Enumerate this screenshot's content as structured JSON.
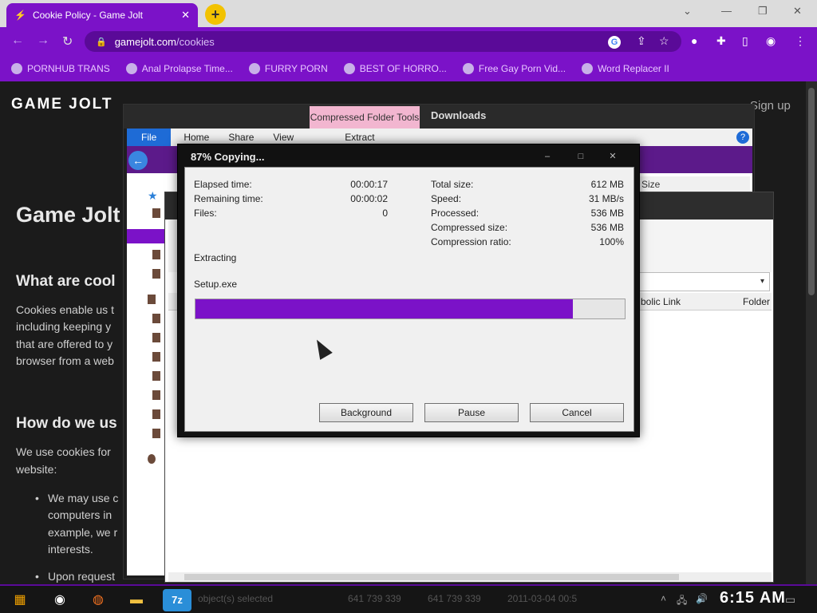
{
  "browser": {
    "tab_title": "Cookie Policy - Game Jolt",
    "tab_close": "✕",
    "new_tab": "+",
    "url_host": "gamejolt.com",
    "url_path": "/cookies",
    "min_glyph": "—",
    "restore_glyph": "❐",
    "close_glyph": "✕",
    "chevron_glyph": "⌄",
    "back_glyph": "←",
    "forward_glyph": "→",
    "reload_glyph": "↻",
    "lock_glyph": "🔒",
    "g_glyph": "G"
  },
  "bookmarks": [
    {
      "label": "PORNHUB TRANS"
    },
    {
      "label": "Anal Prolapse Time..."
    },
    {
      "label": "FURRY PORN"
    },
    {
      "label": "BEST OF HORRO..."
    },
    {
      "label": "Free Gay Porn Vid..."
    },
    {
      "label": "Word Replacer II"
    }
  ],
  "page": {
    "logo": "GAME JOLT",
    "signup": "Sign up",
    "title": "Game Jolt",
    "h_cookies": "What are cool",
    "p_cookies_1": "Cookies enable us t",
    "p_cookies_2": "including keeping y",
    "p_cookies_3": "that are offered to y",
    "p_cookies_4": "browser from a web",
    "h_how": "How do we us",
    "p_how_1": "We use cookies for",
    "p_how_2": "website:",
    "li_1a": "We may use c",
    "li_1b": "computers in",
    "li_1c": "example, we r",
    "li_1d": "interests.",
    "li_2a": "Upon request"
  },
  "explorer": {
    "tools_tab": "Compressed Folder Tools",
    "downloads": "Downloads",
    "ribbon_file": "File",
    "ribbon_home": "Home",
    "ribbon_share": "Share",
    "ribbon_view": "View",
    "ribbon_extract": "Extract",
    "size_col": "Size",
    "help": "?"
  },
  "explorer2": {
    "col_symbolic": "bolic Link",
    "col_folder": "Folder",
    "dropdown": "▾"
  },
  "dialog": {
    "title": "87% Copying...",
    "elapsed_label": "Elapsed time:",
    "elapsed_value": "00:00:17",
    "remaining_label": "Remaining time:",
    "remaining_value": "00:00:02",
    "files_label": "Files:",
    "files_value": "0",
    "total_label": "Total size:",
    "total_value": "612 MB",
    "speed_label": "Speed:",
    "speed_value": "31 MB/s",
    "processed_label": "Processed:",
    "processed_value": "536 MB",
    "compressed_label": "Compressed size:",
    "compressed_value": "536 MB",
    "ratio_label": "Compression ratio:",
    "ratio_value": "100%",
    "status": "Extracting",
    "filename": "Setup.exe",
    "progress_fraction": 0.88,
    "btn_background": "Background",
    "btn_pause": "Pause",
    "btn_cancel": "Cancel",
    "ctl_min": "–",
    "ctl_max": "□",
    "ctl_close": "✕"
  },
  "taskbar": {
    "status_text": "object(s) selected",
    "size_1": "641 739 339",
    "size_2": "641 739 339",
    "date": "2011-03-04 00:5",
    "clock": "6:15 AM",
    "sevenzip": "7z"
  },
  "colors": {
    "accent": "#7b12c8",
    "chrome_dark": "#5a0a98",
    "page_bg": "#1b1b1b"
  }
}
